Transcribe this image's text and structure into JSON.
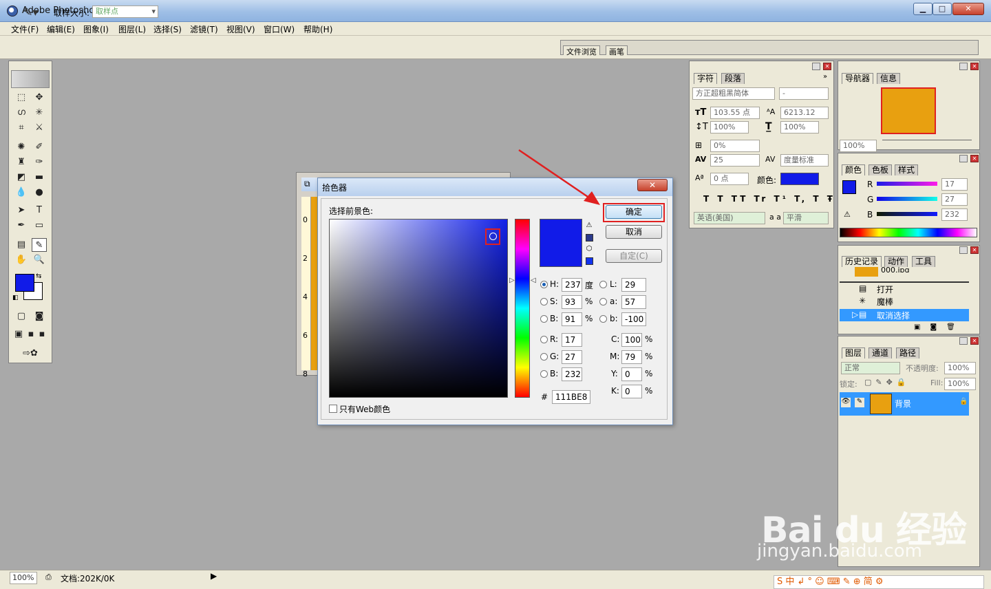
{
  "window": {
    "title": "Adobe Photoshop",
    "min": "▁",
    "max": "□",
    "close": "✕"
  },
  "menu": [
    "文件(F)",
    "编辑(E)",
    "图象(I)",
    "图层(L)",
    "选择(S)",
    "滤镜(T)",
    "视图(V)",
    "窗口(W)",
    "帮助(H)"
  ],
  "options": {
    "sample_label": "取样大小:",
    "sample_value": "取样点"
  },
  "palette_well": {
    "tabs": [
      "文件浏览",
      "画笔"
    ]
  },
  "status": {
    "zoom": "100%",
    "doc": "文档:202K/0K"
  },
  "colors": {
    "foreground": "#111be8",
    "document": "#e8a010",
    "accent_selection": "#3399ff"
  },
  "picker": {
    "title": "拾色器",
    "choose_label": "选择前景色:",
    "ok": "确定",
    "cancel": "取消",
    "custom": "自定(C)",
    "fields": {
      "H": "237",
      "S": "93",
      "B": "91",
      "R": "17",
      "G": "27",
      "Bb": "232",
      "L": "29",
      "a": "57",
      "b": "-100",
      "C": "100",
      "M": "79",
      "Y": "0",
      "K": "0",
      "hex": "111BE8"
    },
    "units": {
      "H": "度",
      "pct": "%"
    },
    "labels": {
      "H": "H:",
      "S": "S:",
      "B": "B:",
      "R": "R:",
      "G": "G:",
      "Bb": "B:",
      "L": "L:",
      "a": "a:",
      "b": "b:",
      "C": "C:",
      "M": "M:",
      "Y": "Y:",
      "K": "K:",
      "hex": "#"
    },
    "web_only": "只有Web颜色"
  },
  "character_panel": {
    "tabs": [
      "字符",
      "段落"
    ],
    "font": "方正超粗黑简体",
    "style": "-",
    "size": "103.55 点",
    "leading": "6213.12",
    "vscale": "100%",
    "hscale": "100%",
    "tracking_pct": "0%",
    "kerning": "25",
    "kern_mode": "度量标准",
    "baseline": "0 点",
    "color_label": "颜色:",
    "language": "英语(美国)",
    "aa_label": "a a",
    "antialias": "平滑",
    "styles": [
      "T",
      "T",
      "TT",
      "Tr",
      "T¹",
      "T,",
      "T",
      "Ŧ"
    ]
  },
  "navigator_panel": {
    "tabs": [
      "导航器",
      "信息"
    ],
    "zoom": "100%"
  },
  "color_panel": {
    "tabs": [
      "颜色",
      "色板",
      "样式"
    ],
    "R": "17",
    "G": "27",
    "B": "232",
    "labels": [
      "R",
      "G",
      "B"
    ]
  },
  "history_panel": {
    "tabs": [
      "历史记录",
      "动作",
      "工具"
    ],
    "items": [
      "打开",
      "魔棒",
      "取消选择"
    ],
    "snapshot": "000.jpg"
  },
  "layers_panel": {
    "tabs": [
      "图层",
      "通道",
      "路径"
    ],
    "blend": "正常",
    "opacity_label": "不透明度:",
    "opacity": "100%",
    "lock_label": "锁定:",
    "fill_label": "Fill:",
    "fill": "100%",
    "layer_name": "背景"
  },
  "watermark": {
    "brand": "Bai du 经验",
    "url": "jingyan.baidu.com"
  },
  "ime": {
    "text": "S 中 ↲ ° ☺ ⌨ ✎ ⊕ 简 ⚙"
  }
}
